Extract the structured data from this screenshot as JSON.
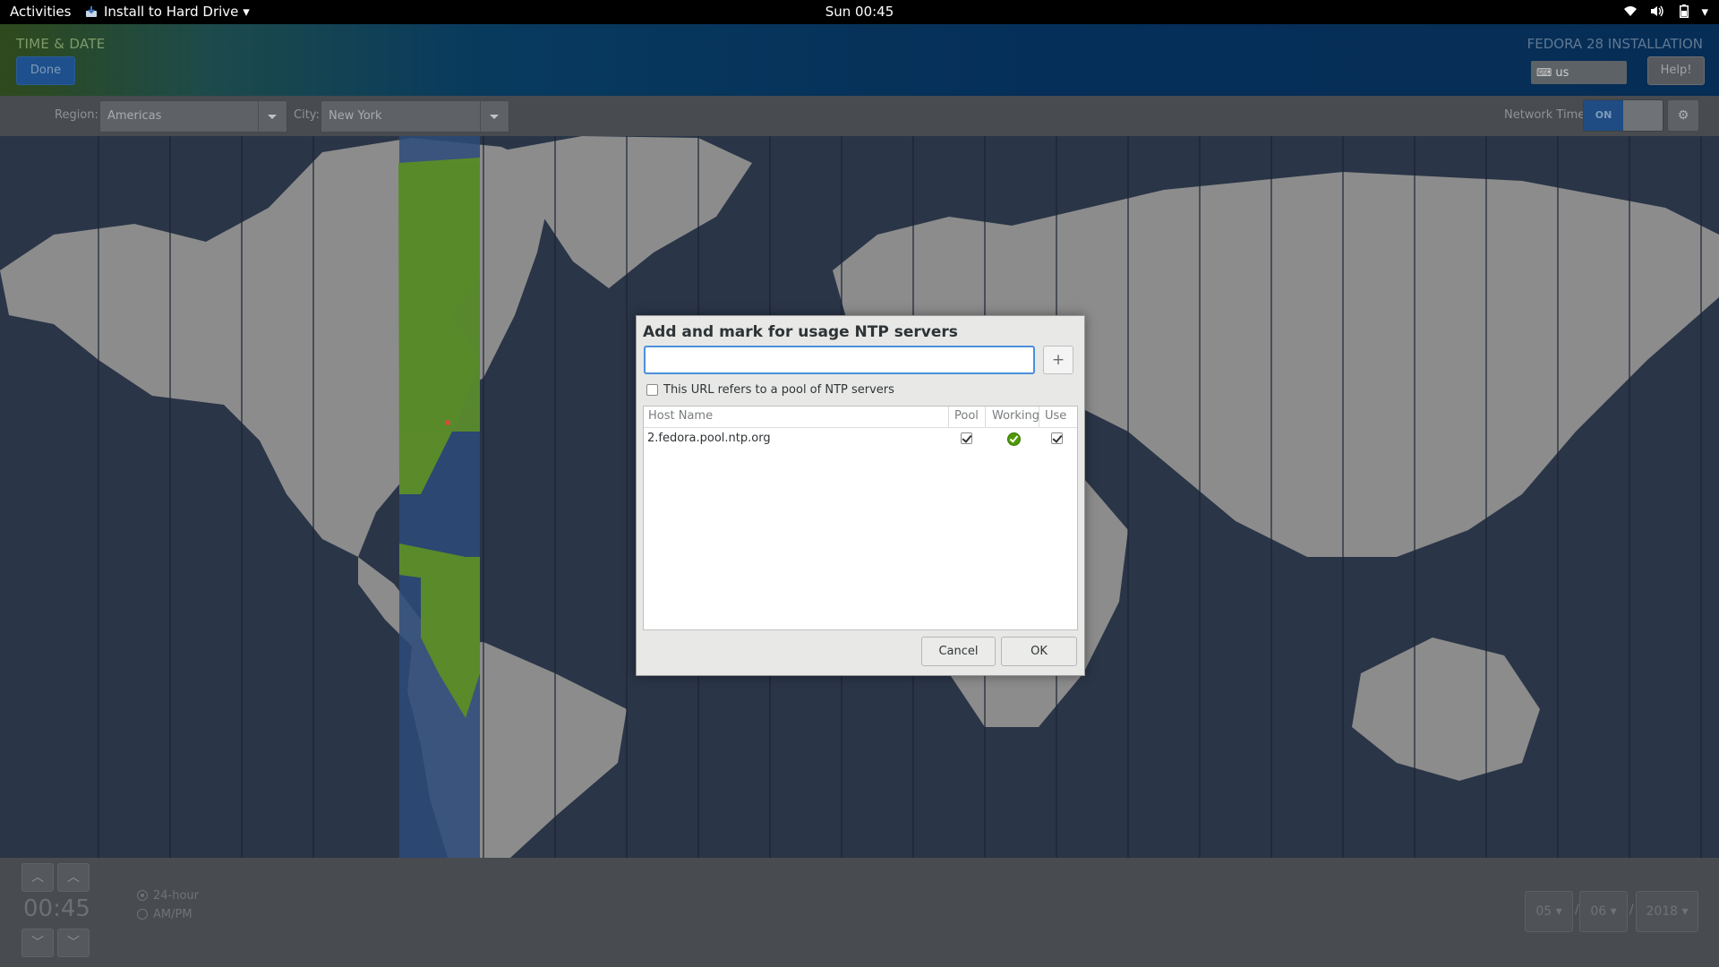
{
  "topbar": {
    "activities": "Activities",
    "app_name": "Install to Hard Drive",
    "clock": "Sun 00:45",
    "tray_icons": [
      "wifi-icon",
      "volume-icon",
      "battery-icon",
      "system-menu-arrow-icon"
    ]
  },
  "header": {
    "title": "TIME & DATE",
    "done_label": "Done",
    "installer_title": "FEDORA 28 INSTALLATION",
    "keyboard_layout": "us",
    "help_label": "Help!"
  },
  "region_bar": {
    "region_label": "Region:",
    "region_value": "Americas",
    "city_label": "City:",
    "city_value": "New York",
    "network_time_label": "Network Time",
    "network_time_state": "ON"
  },
  "colors": {
    "selected_timezone": "#5a8a2a",
    "map_ocean": "#2a3547",
    "map_land": "#8c8c8c",
    "accent": "#4a90d9"
  },
  "time": {
    "value": "00:45",
    "format_24h": "24-hour",
    "format_ampm": "AM/PM",
    "selected_format": "24-hour"
  },
  "date": {
    "month": "05",
    "day": "06",
    "year": "2018",
    "separator": "/"
  },
  "dialog": {
    "title": "Add and mark for usage NTP servers",
    "url_value": "",
    "add_symbol": "+",
    "pool_checkbox_label": "This URL refers to a pool of NTP servers",
    "pool_checkbox_checked": false,
    "columns": [
      "Host Name",
      "Pool",
      "Working",
      "Use"
    ],
    "servers": [
      {
        "host": "2.fedora.pool.ntp.org",
        "pool": true,
        "working": true,
        "use": true
      }
    ],
    "cancel_label": "Cancel",
    "ok_label": "OK"
  }
}
